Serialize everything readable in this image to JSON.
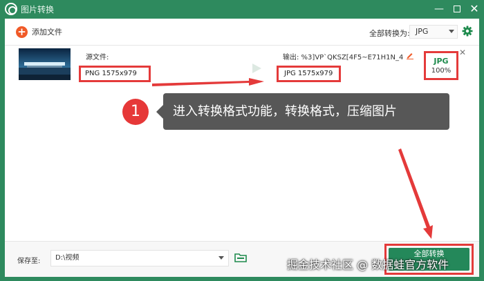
{
  "window": {
    "title": "图片转换",
    "minimize": "—",
    "close": "✕"
  },
  "toolbar": {
    "add_file": "添加文件",
    "convert_all_to_label": "全部转换为:",
    "format": "JPG"
  },
  "file_row": {
    "source_label": "源文件:",
    "source_info": "PNG  1575x979",
    "output_label": "输出: %3]VP`QKSZ[4F5~E71H1N_4",
    "output_info": "JPG  1575x979",
    "target_format": "JPG",
    "progress": "100%",
    "remove": "✕"
  },
  "annotation": {
    "step": "1",
    "text": "进入转换格式功能，转换格式，压缩图片"
  },
  "bottom": {
    "save_to_label": "保存至:",
    "save_path": "D:\\视频",
    "convert_all_button": "全部转换"
  },
  "watermark": "掘金技术社区 @ 数据蛙官方软件",
  "colors": {
    "brand_green": "#2e8a5e",
    "highlight_red": "#e43a3a",
    "add_orange": "#f05a28"
  },
  "icons": [
    "app-logo-icon",
    "plus-icon",
    "gear-icon",
    "edit-icon",
    "close-icon",
    "folder-icon",
    "dropdown-caret-icon"
  ]
}
